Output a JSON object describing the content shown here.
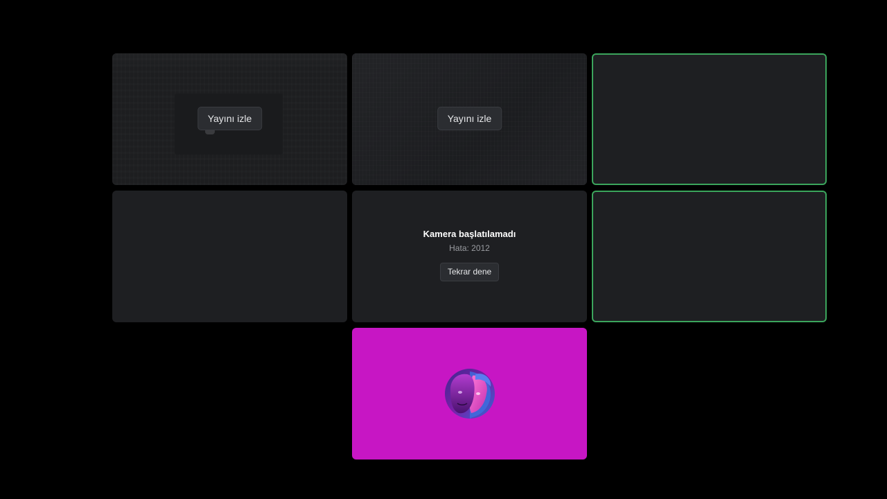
{
  "tiles": {
    "stream1": {
      "watch_label": "Yayını izle"
    },
    "stream2": {
      "watch_label": "Yayını izle"
    },
    "camera_error": {
      "title": "Kamera başlatılamadı",
      "code": "Hata: 2012",
      "retry_label": "Tekrar dene"
    },
    "avatar_tile": {
      "background": "#c716c4"
    }
  },
  "colors": {
    "background": "#000000",
    "tile": "#1e1f22",
    "speaking_border": "#3ba55c",
    "button": "#2b2d31"
  }
}
